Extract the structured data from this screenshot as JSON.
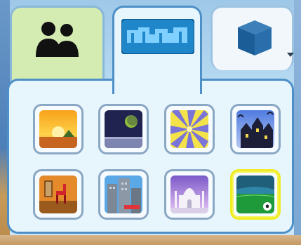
{
  "tabs": [
    {
      "id": "people",
      "icon": "people-icon",
      "selected": false
    },
    {
      "id": "places",
      "icon": "city-skyline-icon",
      "selected": true
    },
    {
      "id": "objects",
      "icon": "box-icon",
      "selected": false,
      "has_dropdown": true
    }
  ],
  "grid": {
    "items": [
      {
        "name": "sunset-scene-icon"
      },
      {
        "name": "moon-night-scene-icon"
      },
      {
        "name": "sunburst-scene-icon"
      },
      {
        "name": "haunted-house-scene-icon"
      },
      {
        "name": "room-with-chair-scene-icon"
      },
      {
        "name": "city-buildings-scene-icon"
      },
      {
        "name": "palace-scene-icon"
      },
      {
        "name": "soccer-field-scene-icon",
        "selected": true
      }
    ]
  },
  "colors": {
    "accent": "#4d8fc7",
    "people_tab": "#d4ecb1",
    "selected_border": "#f0ec22"
  }
}
